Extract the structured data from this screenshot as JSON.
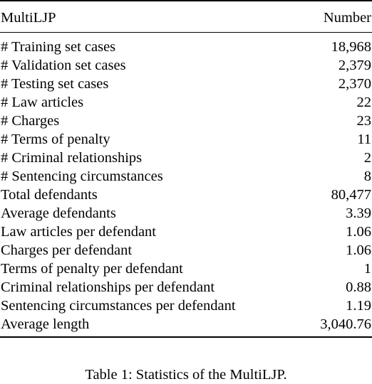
{
  "table": {
    "columns": [
      {
        "key": "label",
        "header": "MultiLJP",
        "align": "left"
      },
      {
        "key": "value",
        "header": "Number",
        "align": "right"
      }
    ],
    "header": {
      "label": "MultiLJP",
      "value": "Number"
    },
    "rows": [
      {
        "label": "# Training set cases",
        "value": "18,968"
      },
      {
        "label": "# Validation set cases",
        "value": "2,379"
      },
      {
        "label": "# Testing set cases",
        "value": "2,370"
      },
      {
        "label": "# Law articles",
        "value": "22"
      },
      {
        "label": "# Charges",
        "value": "23"
      },
      {
        "label": "# Terms of penalty",
        "value": "11"
      },
      {
        "label": "# Criminal relationships",
        "value": "2"
      },
      {
        "label": "# Sentencing circumstances",
        "value": "8"
      },
      {
        "label": "Total defendants",
        "value": "80,477"
      },
      {
        "label": "Average defendants",
        "value": "3.39"
      },
      {
        "label": "Law articles per defendant",
        "value": "1.06"
      },
      {
        "label": "Charges per defendant",
        "value": "1.06"
      },
      {
        "label": "Terms of penalty per defendant",
        "value": "1"
      },
      {
        "label": "Criminal relationships per defendant",
        "value": "0.88"
      },
      {
        "label": "Sentencing circumstances per defendant",
        "value": "1.19"
      },
      {
        "label": "Average length",
        "value": "3,040.76"
      }
    ]
  },
  "caption": {
    "text": "Table 1: Statistics of the MultiLJP."
  },
  "style": {
    "text_color": "#000000",
    "background_color": "#ffffff",
    "rule_color": "#000000"
  }
}
